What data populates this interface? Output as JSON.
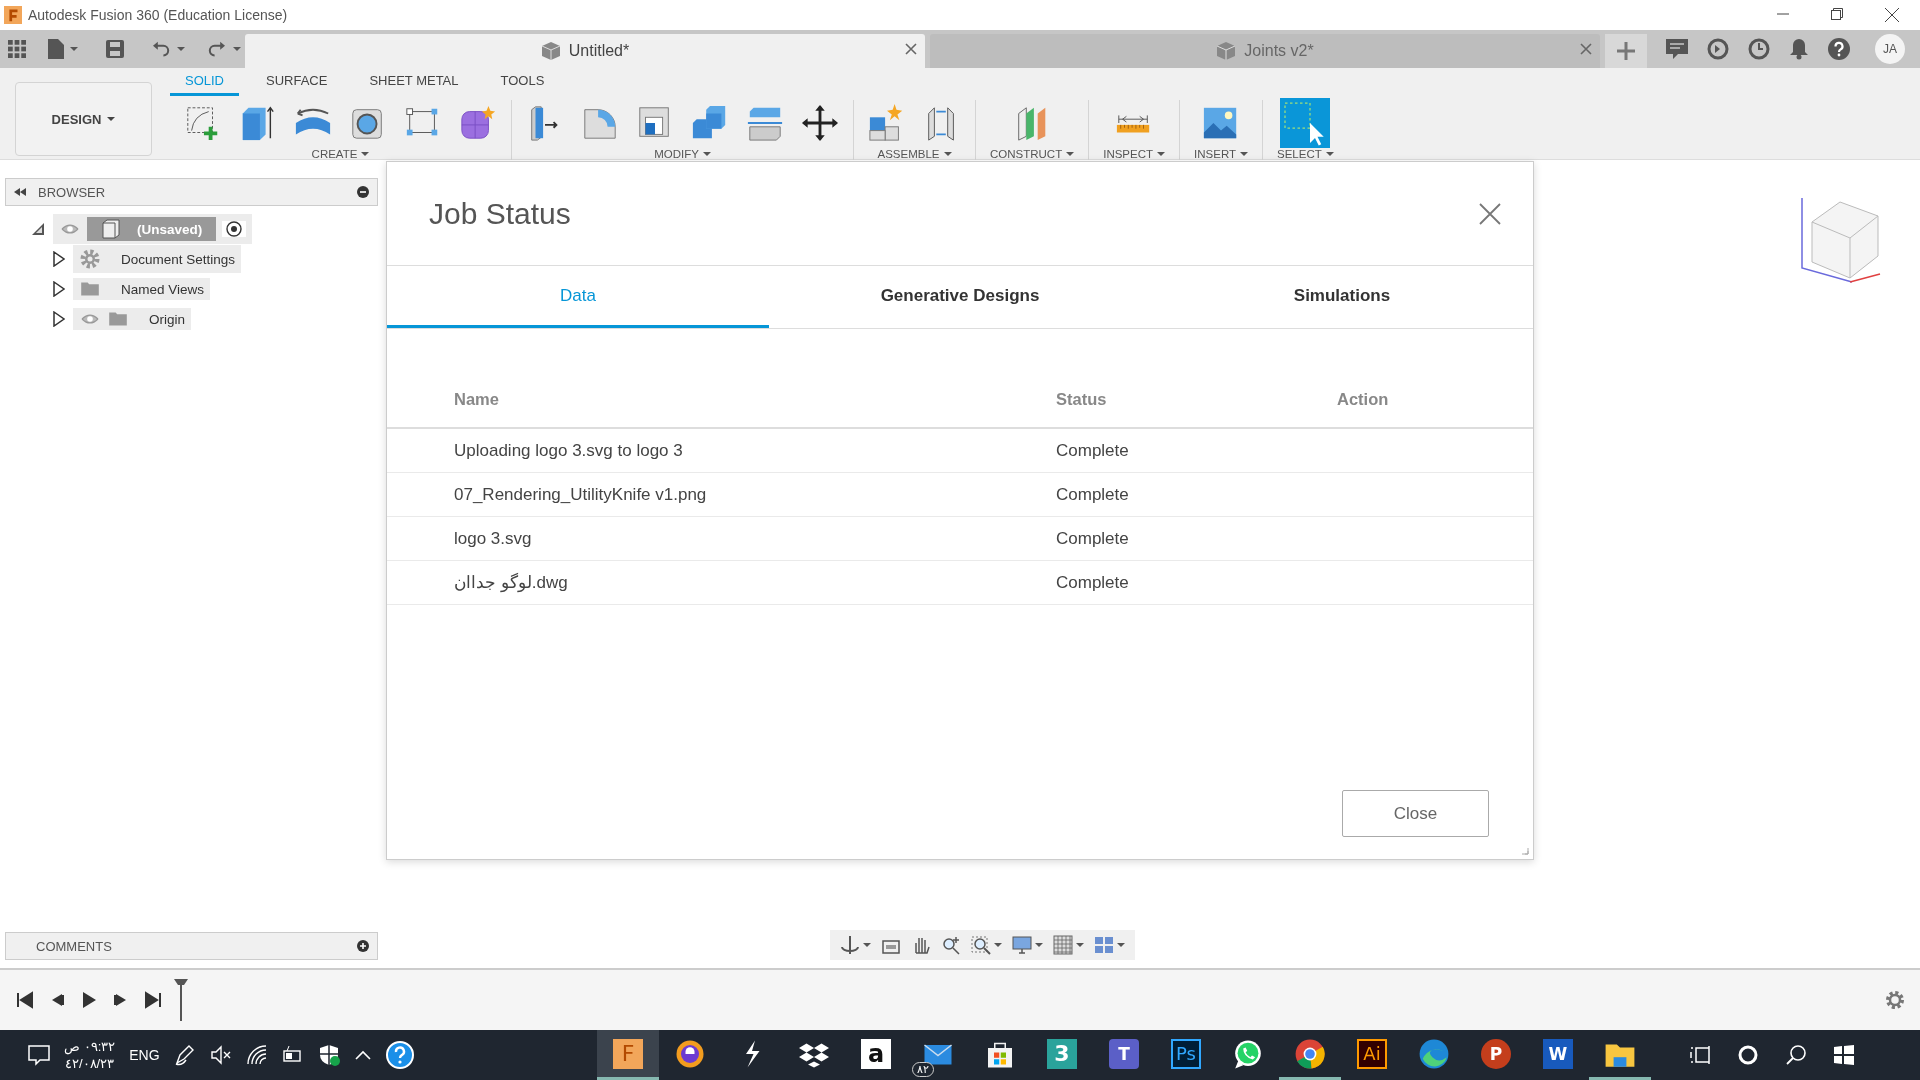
{
  "window": {
    "title": "Autodesk Fusion 360 (Education License)"
  },
  "document_tabs": [
    {
      "title": "Untitled*",
      "selected": true
    },
    {
      "title": "Joints v2*",
      "selected": false
    }
  ],
  "user": {
    "initials": "JA"
  },
  "toolbar": {
    "workspace": "DESIGN",
    "tabs": [
      {
        "label": "SOLID",
        "selected": true
      },
      {
        "label": "SURFACE",
        "selected": false
      },
      {
        "label": "SHEET METAL",
        "selected": false
      },
      {
        "label": "TOOLS",
        "selected": false
      }
    ],
    "groups": [
      {
        "label": "CREATE",
        "tools": [
          {
            "kind": "sketch"
          },
          {
            "kind": "extrude"
          },
          {
            "kind": "revolve"
          },
          {
            "kind": "hole"
          },
          {
            "kind": "pattern"
          },
          {
            "kind": "form"
          }
        ]
      },
      {
        "label": "MODIFY",
        "tools": [
          {
            "kind": "presspull"
          },
          {
            "kind": "fillet"
          },
          {
            "kind": "shell"
          },
          {
            "kind": "combine"
          },
          {
            "kind": "split"
          },
          {
            "kind": "move"
          }
        ]
      },
      {
        "label": "ASSEMBLE",
        "tools": [
          {
            "kind": "component"
          },
          {
            "kind": "joint"
          }
        ]
      },
      {
        "label": "CONSTRUCT",
        "tools": [
          {
            "kind": "plane"
          }
        ]
      },
      {
        "label": "INSPECT",
        "tools": [
          {
            "kind": "measure"
          }
        ]
      },
      {
        "label": "INSERT",
        "tools": [
          {
            "kind": "image"
          }
        ]
      },
      {
        "label": "SELECT",
        "tools": [
          {
            "kind": "select"
          }
        ]
      }
    ]
  },
  "browser": {
    "title": "BROWSER",
    "items": [
      {
        "label": "(Unsaved)",
        "kind": "component",
        "expanded": true,
        "children": [
          {
            "label": "Document Settings",
            "kind": "settings",
            "expanded": false
          },
          {
            "label": "Named Views",
            "kind": "folder",
            "expanded": false
          },
          {
            "label": "Origin",
            "kind": "visible-folder",
            "expanded": false
          }
        ]
      }
    ]
  },
  "dialog": {
    "title": "Job Status",
    "tabs": [
      {
        "label": "Data",
        "selected": true
      },
      {
        "label": "Generative Designs",
        "selected": false
      },
      {
        "label": "Simulations",
        "selected": false
      }
    ],
    "columns": [
      "Name",
      "Status",
      "Action"
    ],
    "rows": [
      {
        "name": "Uploading logo 3.svg to logo 3",
        "status": "Complete"
      },
      {
        "name": "07_Rendering_UtilityKnife v1.png",
        "status": "Complete"
      },
      {
        "name": "logo 3.svg",
        "status": "Complete"
      },
      {
        "name": "لوگو جداان.dwg",
        "status": "Complete"
      }
    ],
    "button": "Close"
  },
  "comments": {
    "title": "COMMENTS"
  },
  "taskbar": {
    "time": "٠٩:٣٢ ص",
    "date": "٤٢/٠٨/٢٣",
    "language": "ENG",
    "apps": [
      {
        "kind": "fusion",
        "label": "F",
        "running": true,
        "focused": true
      },
      {
        "kind": "shield-browser",
        "running": false,
        "focused": false
      },
      {
        "kind": "bolt",
        "running": false,
        "focused": false
      },
      {
        "kind": "dropbox",
        "running": false,
        "focused": false
      },
      {
        "kind": "amazon",
        "label": "a",
        "running": false,
        "focused": false
      },
      {
        "kind": "mail",
        "badge": "٨٢",
        "running": false,
        "focused": false
      },
      {
        "kind": "store",
        "running": false,
        "focused": false
      },
      {
        "kind": "max",
        "label": "3",
        "running": false,
        "focused": false
      },
      {
        "kind": "teams",
        "label": "T",
        "running": false,
        "focused": false
      },
      {
        "kind": "photoshop",
        "label": "Ps",
        "running": false,
        "focused": false
      },
      {
        "kind": "whatsapp",
        "running": false,
        "focused": false
      },
      {
        "kind": "chrome",
        "running": true,
        "focused": false
      },
      {
        "kind": "illustrator",
        "label": "Ai",
        "running": false,
        "focused": false
      },
      {
        "kind": "edge",
        "running": false,
        "focused": false
      },
      {
        "kind": "powerpoint",
        "label": "P",
        "running": false,
        "focused": false
      },
      {
        "kind": "word",
        "label": "W",
        "running": false,
        "focused": false
      },
      {
        "kind": "explorer",
        "running": true,
        "focused": false
      }
    ]
  }
}
